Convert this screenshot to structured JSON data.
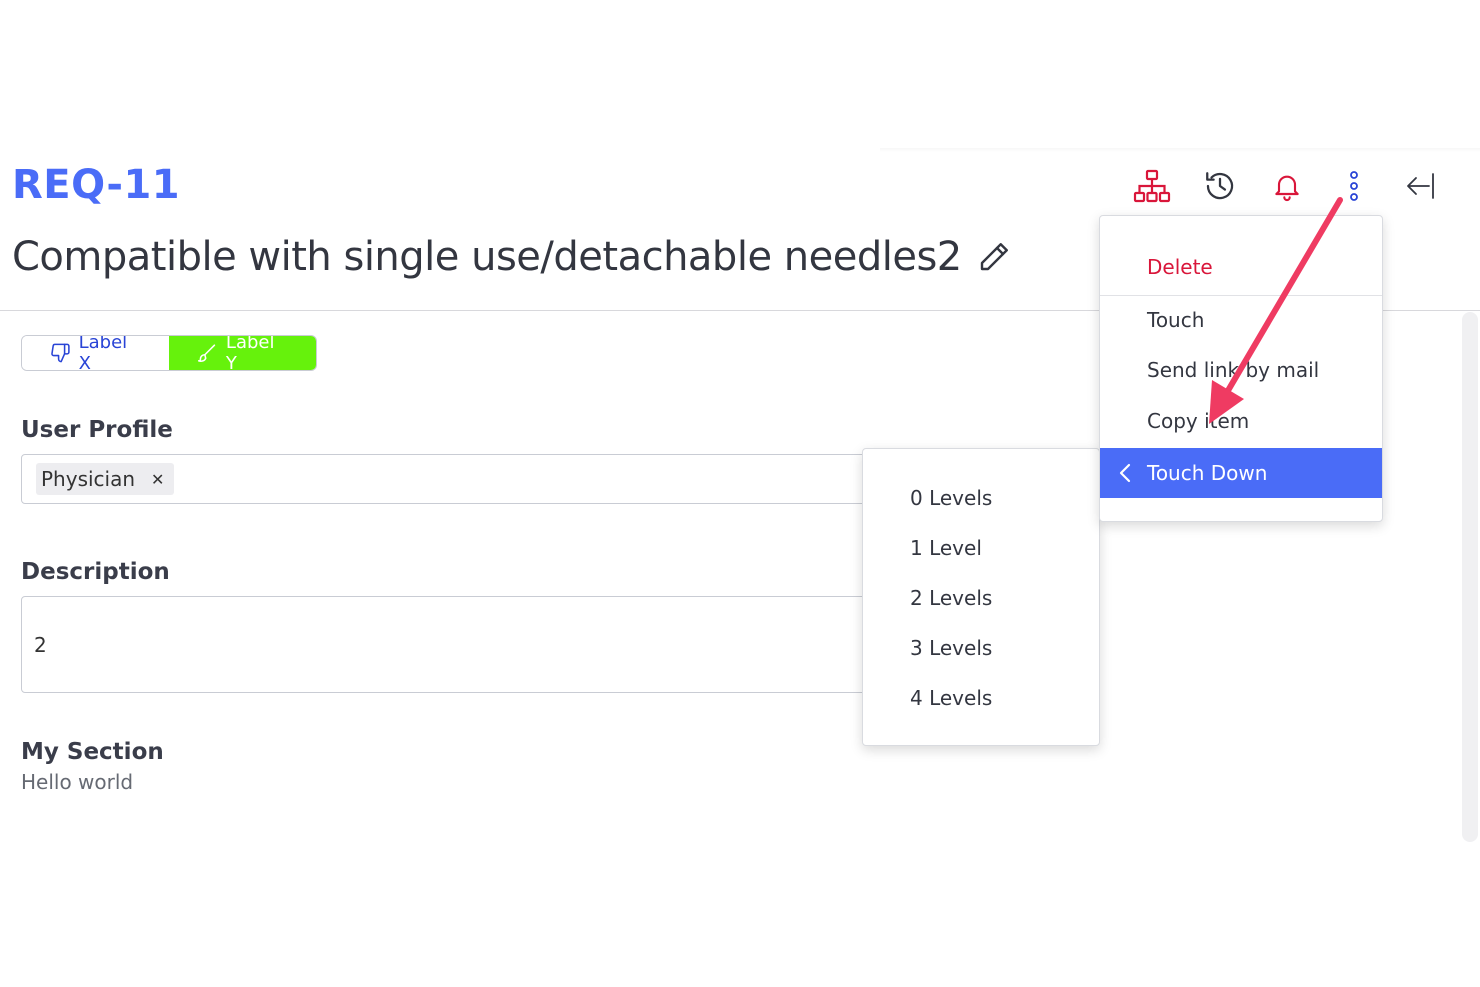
{
  "header": {
    "req_id": "REQ-11",
    "title": "Compatible with single use/detachable needles2",
    "toolbar_icons": [
      "hierarchy-icon",
      "history-icon",
      "bell-icon",
      "more-vertical-icon",
      "collapse-left-icon"
    ]
  },
  "labels": {
    "label_x": "Label X",
    "label_y": "Label Y"
  },
  "fields": {
    "user_profile": {
      "label": "User Profile",
      "chips": [
        "Physician"
      ]
    },
    "description": {
      "label": "Description",
      "value": "2"
    },
    "my_section": {
      "label": "My Section",
      "value": "Hello world"
    }
  },
  "context_menu": {
    "items": {
      "delete": "Delete",
      "touch": "Touch",
      "send_link": "Send link by mail",
      "copy_item": "Copy item",
      "touch_down": "Touch Down"
    }
  },
  "submenu": {
    "items": [
      "0 Levels",
      "1 Level",
      "2 Levels",
      "3 Levels",
      "4 Levels"
    ]
  },
  "colors": {
    "accent_blue": "#4a6cf7",
    "danger_red": "#d9163a",
    "label_green": "#66f20c",
    "annotation_arrow": "#ef3b62"
  }
}
